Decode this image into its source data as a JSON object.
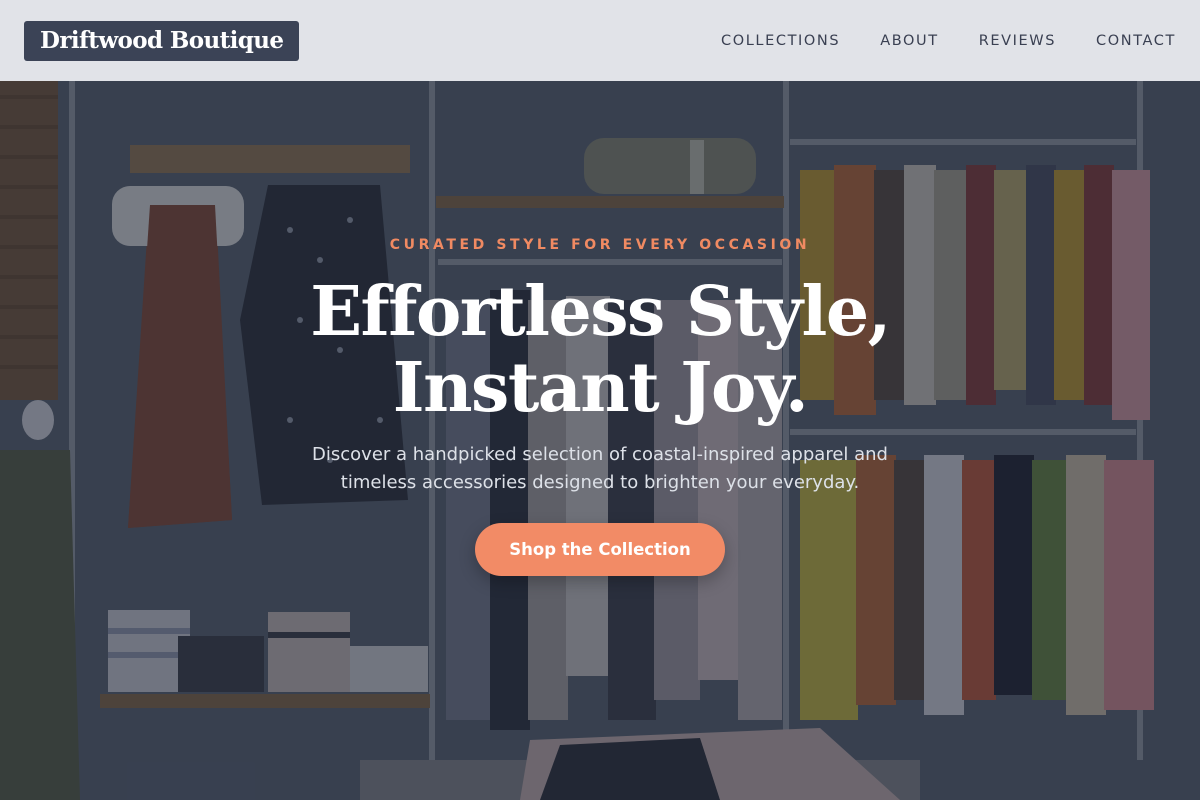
{
  "header": {
    "logo_text": "Driftwood Boutique",
    "nav": [
      {
        "label": "COLLECTIONS"
      },
      {
        "label": "ABOUT"
      },
      {
        "label": "REVIEWS"
      },
      {
        "label": "CONTACT"
      }
    ]
  },
  "hero": {
    "eyebrow": "CURATED STYLE FOR EVERY OCCASION",
    "headline_line1": "Effortless Style,",
    "headline_line2": "Instant Joy.",
    "subtext": "Discover a handpicked selection of coastal-inspired apparel and timeless accessories designed to brighten your everyday.",
    "cta_label": "Shop the Collection",
    "background_image": "boutique-clothing-racks-photo"
  },
  "colors": {
    "accent": "#f28b66",
    "eyebrow": "#f08a62",
    "logo_bg": "#3b4356",
    "header_bg": "#e8eaee",
    "nav_text": "#3a4052"
  }
}
